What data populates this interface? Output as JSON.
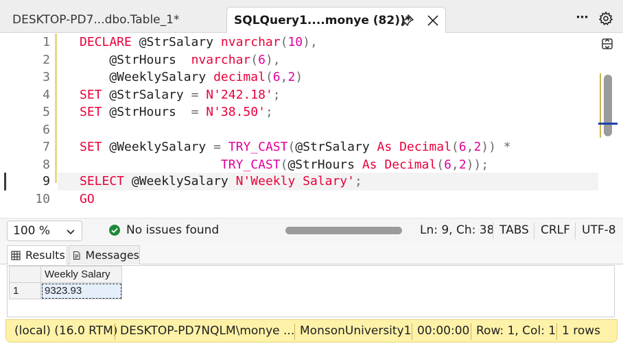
{
  "tabs": [
    {
      "title": "DESKTOP-PD7...dbo.Table_1*",
      "active": false
    },
    {
      "title": "SQLQuery1....monye (82))*",
      "active": true
    }
  ],
  "toolbar": {
    "more_label": "⋯"
  },
  "editor": {
    "line_numbers": [
      "1",
      "2",
      "3",
      "4",
      "5",
      "6",
      "7",
      "8",
      "9",
      "10"
    ],
    "current_line": 9,
    "lines": [
      [
        {
          "t": "DECLARE",
          "c": "kw"
        },
        {
          "t": " @StrSalary ",
          "c": "var"
        },
        {
          "t": "nvarchar",
          "c": "kw"
        },
        {
          "t": "(",
          "c": "op"
        },
        {
          "t": "10",
          "c": "num"
        },
        {
          "t": "),",
          "c": "op"
        }
      ],
      [
        {
          "t": "    @StrHours  ",
          "c": "var"
        },
        {
          "t": "nvarchar",
          "c": "kw"
        },
        {
          "t": "(",
          "c": "op"
        },
        {
          "t": "6",
          "c": "num"
        },
        {
          "t": "),",
          "c": "op"
        }
      ],
      [
        {
          "t": "    @WeeklySalary ",
          "c": "var"
        },
        {
          "t": "decimal",
          "c": "kw"
        },
        {
          "t": "(",
          "c": "op"
        },
        {
          "t": "6",
          "c": "num"
        },
        {
          "t": ",",
          "c": "op"
        },
        {
          "t": "2",
          "c": "num"
        },
        {
          "t": ")",
          "c": "op"
        }
      ],
      [
        {
          "t": "SET",
          "c": "kw"
        },
        {
          "t": " @StrSalary ",
          "c": "var"
        },
        {
          "t": "=",
          "c": "op"
        },
        {
          "t": " ",
          "c": "var"
        },
        {
          "t": "N'242.18'",
          "c": "str"
        },
        {
          "t": ";",
          "c": "op"
        }
      ],
      [
        {
          "t": "SET",
          "c": "kw"
        },
        {
          "t": " @StrHours  ",
          "c": "var"
        },
        {
          "t": "=",
          "c": "op"
        },
        {
          "t": " ",
          "c": "var"
        },
        {
          "t": "N'38.50'",
          "c": "str"
        },
        {
          "t": ";",
          "c": "op"
        }
      ],
      [],
      [
        {
          "t": "SET",
          "c": "kw"
        },
        {
          "t": " @WeeklySalary ",
          "c": "var"
        },
        {
          "t": "=",
          "c": "op"
        },
        {
          "t": " ",
          "c": "var"
        },
        {
          "t": "TRY_CAST",
          "c": "fn"
        },
        {
          "t": "(",
          "c": "op"
        },
        {
          "t": "@StrSalary ",
          "c": "var"
        },
        {
          "t": "As",
          "c": "kw"
        },
        {
          "t": " ",
          "c": "var"
        },
        {
          "t": "Decimal",
          "c": "kw"
        },
        {
          "t": "(",
          "c": "op"
        },
        {
          "t": "6",
          "c": "num"
        },
        {
          "t": ",",
          "c": "op"
        },
        {
          "t": "2",
          "c": "num"
        },
        {
          "t": ")) *",
          "c": "op"
        }
      ],
      [
        {
          "t": "                   ",
          "c": "var"
        },
        {
          "t": "TRY_CAST",
          "c": "fn"
        },
        {
          "t": "(",
          "c": "op"
        },
        {
          "t": "@StrHours ",
          "c": "var"
        },
        {
          "t": "As",
          "c": "kw"
        },
        {
          "t": " ",
          "c": "var"
        },
        {
          "t": "Decimal",
          "c": "kw"
        },
        {
          "t": "(",
          "c": "op"
        },
        {
          "t": "6",
          "c": "num"
        },
        {
          "t": ",",
          "c": "op"
        },
        {
          "t": "2",
          "c": "num"
        },
        {
          "t": "));",
          "c": "op"
        }
      ],
      [
        {
          "t": "SELECT",
          "c": "kw"
        },
        {
          "t": " @WeeklySalary ",
          "c": "var"
        },
        {
          "t": "N'Weekly Salary'",
          "c": "str"
        },
        {
          "t": ";",
          "c": "op"
        }
      ],
      [
        {
          "t": "GO",
          "c": "kw"
        }
      ]
    ]
  },
  "editor_status": {
    "zoom": "100 %",
    "issues": "No issues found",
    "position": "Ln: 9, Ch: 38",
    "tabs_mode": "TABS",
    "line_endings": "CRLF",
    "encoding": "UTF-8"
  },
  "results": {
    "tabs": {
      "results": "Results",
      "messages": "Messages"
    },
    "columns": [
      "Weekly Salary"
    ],
    "rows": [
      {
        "num": "1",
        "values": [
          "9323.93"
        ]
      }
    ]
  },
  "status_bar": {
    "server": "(local) (16.0 RTM)",
    "login": "DESKTOP-PD7NQLM\\monye ...",
    "database": "MonsonUniversity1",
    "elapsed": "00:00:00",
    "row_col": "Row: 1, Col: 1",
    "row_count": "1 rows"
  },
  "colors": {
    "keyword": "#e8003a",
    "function": "#e0009a",
    "status_bar": "#fdf2a8",
    "accent": "#1f3fae"
  }
}
